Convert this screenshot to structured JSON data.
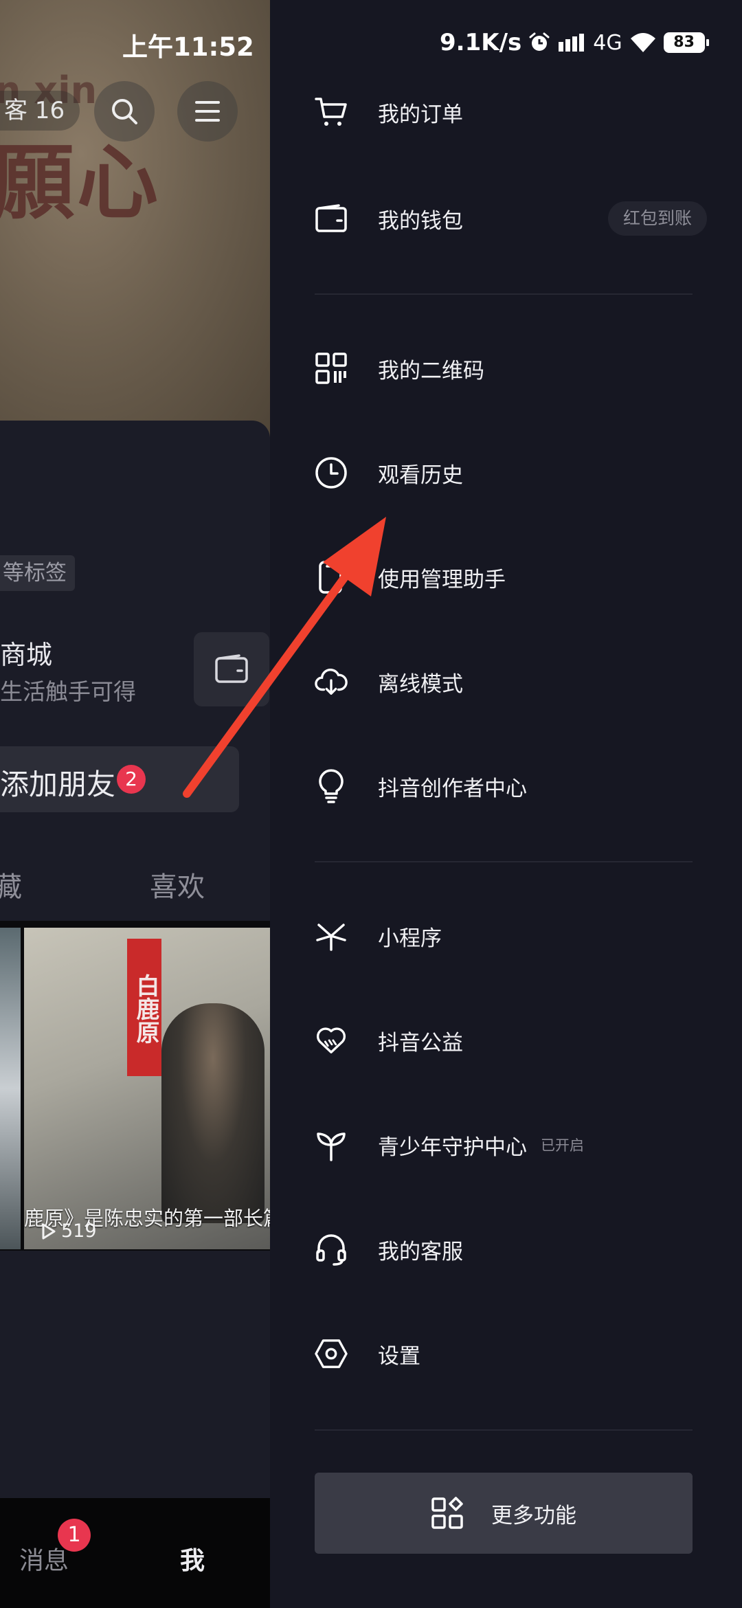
{
  "status_bar": {
    "time": "上午11:52",
    "net_speed": "9.1K/s",
    "network": "4G",
    "battery": "83"
  },
  "profile": {
    "visitor": "客 16",
    "tag_chip": "等标签",
    "mall_title": "商城",
    "mall_sub": "生活触手可得",
    "add_friend": "添加朋友",
    "add_friend_badge": "2",
    "tabs": {
      "fav": "藏",
      "like": "喜欢"
    },
    "video": {
      "book_title": "白鹿原",
      "caption": "鹿原》是陈忠实的第一部长篇",
      "plays": "519"
    },
    "nav": {
      "messages": "消息",
      "messages_badge": "1",
      "me": "我"
    }
  },
  "drawer": {
    "items": [
      {
        "label": "我的订单",
        "icon": "cart-icon"
      },
      {
        "label": "我的钱包",
        "icon": "wallet-icon",
        "pill": "红包到账"
      },
      {
        "label": "我的二维码",
        "icon": "qrcode-icon"
      },
      {
        "label": "观看历史",
        "icon": "clock-icon"
      },
      {
        "label": "使用管理助手",
        "icon": "phone-manager-icon"
      },
      {
        "label": "离线模式",
        "icon": "cloud-download-icon"
      },
      {
        "label": "抖音创作者中心",
        "icon": "lightbulb-icon"
      },
      {
        "label": "小程序",
        "icon": "mini-program-icon"
      },
      {
        "label": "抖音公益",
        "icon": "heart-hands-icon"
      },
      {
        "label": "青少年守护中心",
        "icon": "sprout-icon",
        "note": "已开启"
      },
      {
        "label": "我的客服",
        "icon": "headset-icon"
      },
      {
        "label": "设置",
        "icon": "hexagon-settings-icon"
      }
    ],
    "more_label": "更多功能"
  },
  "colors": {
    "drawer_bg": "#161722",
    "accent_red": "#e8364f",
    "arrow_red": "#f0412e"
  }
}
